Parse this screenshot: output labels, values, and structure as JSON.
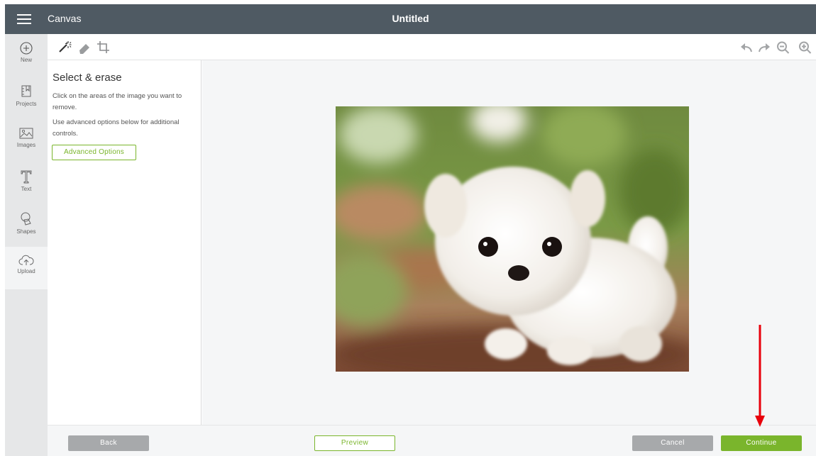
{
  "header": {
    "menu_icon": "hamburger-menu-icon",
    "app_name": "Canvas",
    "doc_title": "Untitled"
  },
  "sidebar": {
    "items": [
      {
        "label": "New",
        "icon": "plus-circle-icon"
      },
      {
        "label": "Projects",
        "icon": "projects-icon"
      },
      {
        "label": "Images",
        "icon": "image-icon"
      },
      {
        "label": "Text",
        "icon": "text-icon"
      },
      {
        "label": "Shapes",
        "icon": "shapes-icon"
      },
      {
        "label": "Upload",
        "icon": "upload-cloud-icon",
        "active": true
      }
    ]
  },
  "toolbar": {
    "tools": [
      "magic-wand-icon",
      "eraser-icon",
      "crop-icon"
    ],
    "right_tools": [
      "undo-icon",
      "redo-icon",
      "zoom-out-icon",
      "zoom-in-icon"
    ]
  },
  "panel": {
    "title": "Select & erase",
    "line1": "Click on the areas of the image you want to",
    "line2": "remove.",
    "line3": "Use advanced options below for additional",
    "line4": "controls.",
    "advanced_button": "Advanced Options"
  },
  "footer": {
    "back": "Back",
    "preview": "Preview",
    "cancel": "Cancel",
    "continue": "Continue"
  },
  "colors": {
    "topbar": "#4f5a63",
    "accent_green": "#7ab52c",
    "grey_button": "#a7a9ab",
    "annotation_arrow": "#e8000b"
  }
}
